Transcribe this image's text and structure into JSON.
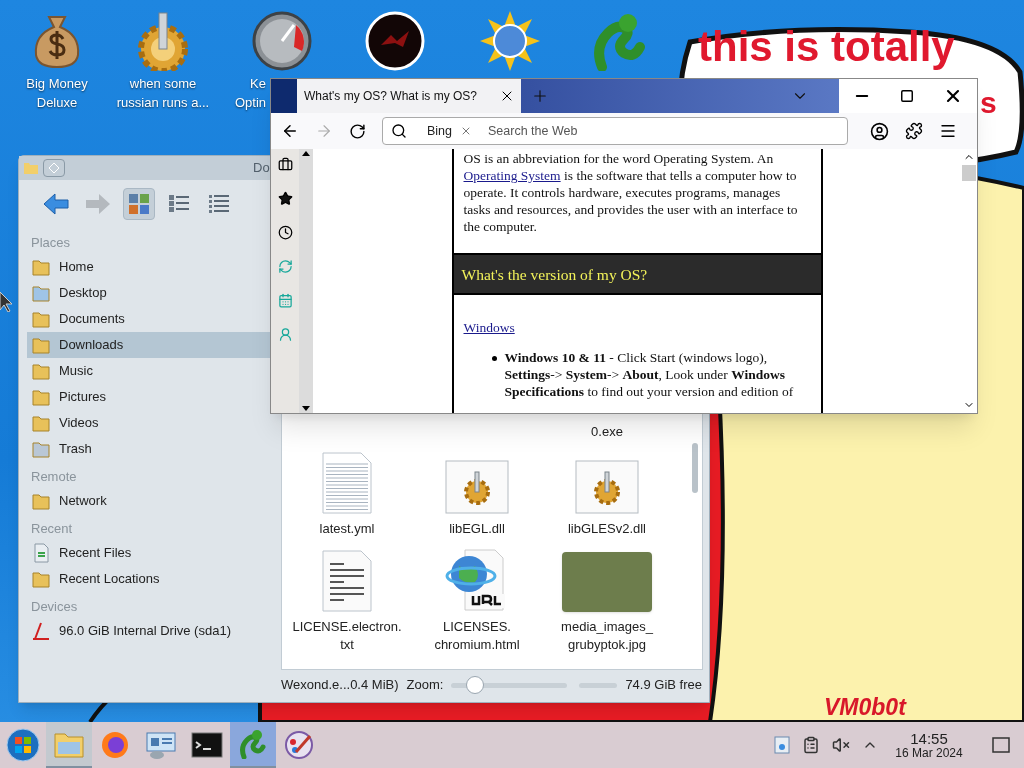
{
  "desktop_icons": [
    {
      "kind": "money",
      "lines": [
        "Big Money",
        "Deluxe"
      ]
    },
    {
      "kind": "gear",
      "lines": [
        "when some",
        "russian runs a..."
      ]
    },
    {
      "kind": "gauge",
      "lines": [
        "Ke",
        "Optin"
      ]
    },
    {
      "kind": "dark"
    },
    {
      "kind": "sun"
    },
    {
      "kind": "snake"
    }
  ],
  "wallpaper": {
    "bubble_text": "this is totally",
    "bubble_tail": "s",
    "signature": "VM0b0t"
  },
  "file_manager": {
    "title": "Do",
    "view_modes": [
      {
        "kind": "icons",
        "selected": true
      },
      {
        "kind": "details",
        "selected": false
      },
      {
        "kind": "compact",
        "selected": false
      }
    ],
    "sections": [
      {
        "title": "Places",
        "items": [
          {
            "kind": "home",
            "label": "Home",
            "selected": false
          },
          {
            "kind": "desktop",
            "label": "Desktop",
            "selected": false
          },
          {
            "kind": "folder",
            "label": "Documents",
            "selected": false
          },
          {
            "kind": "folder",
            "label": "Downloads",
            "selected": true
          },
          {
            "kind": "folder",
            "label": "Music",
            "selected": false
          },
          {
            "kind": "folder",
            "label": "Pictures",
            "selected": false
          },
          {
            "kind": "folder",
            "label": "Videos",
            "selected": false
          },
          {
            "kind": "trash",
            "label": "Trash",
            "selected": false
          }
        ]
      },
      {
        "title": "Remote",
        "items": [
          {
            "kind": "network",
            "label": "Network",
            "selected": false
          }
        ]
      },
      {
        "title": "Recent",
        "items": [
          {
            "kind": "recent",
            "label": "Recent Files",
            "selected": false
          },
          {
            "kind": "folder",
            "label": "Recent Locations",
            "selected": false
          }
        ]
      },
      {
        "title": "Devices",
        "items": [
          {
            "kind": "drive",
            "label": "96.0 GiB Internal Drive (sda1)",
            "selected": false
          }
        ]
      }
    ],
    "partial_label": "0.exe",
    "files": [
      {
        "kind": "text",
        "lines": [
          "latest.yml"
        ]
      },
      {
        "kind": "dll",
        "lines": [
          "libEGL.dll"
        ]
      },
      {
        "kind": "dll",
        "lines": [
          "libGLESv2.dll"
        ]
      },
      {
        "kind": "document",
        "lines": [
          "LICENSE.electron.",
          "txt"
        ]
      },
      {
        "kind": "url",
        "lines": [
          "LICENSES.",
          "chromium.html"
        ]
      },
      {
        "kind": "photo",
        "lines": [
          "media_images_",
          "grubyptok.jpg"
        ]
      }
    ],
    "status_text": "Wexond.e...0.4 MiB)",
    "zoom_label": "Zoom:",
    "zoom": {
      "level": 0.15
    },
    "free_space": "74.9 GiB free"
  },
  "browser": {
    "tab_title": "What's my OS? What is my OS?",
    "search_engine": "Bing",
    "search_placeholder": "Search the Web",
    "intro_before": "OS is an abbreviation for the word Operating System. An",
    "intro_link": "Operating System",
    "intro_after": "is the software that tells a computer how to operate. It controls hardware, executes programs, manages tasks and resources, and provides the user with an interface to the computer.",
    "heading": "What's the version of my OS?",
    "section_link": "Windows",
    "bullets": [
      "**Windows 10 & 11** - Click Start (windows logo), **Settings**-> **System**-> **About**, Look under **Windows Specifications** to find out your version and edition of"
    ]
  },
  "taskbar": {
    "items": [
      {
        "kind": "files",
        "open": true,
        "selected": false
      },
      {
        "kind": "firefox",
        "open": false,
        "selected": false
      },
      {
        "kind": "network",
        "open": false,
        "selected": false
      },
      {
        "kind": "terminal",
        "open": false,
        "selected": false
      },
      {
        "kind": "snake",
        "open": true,
        "selected": true
      },
      {
        "kind": "paint",
        "open": false,
        "selected": false
      }
    ],
    "time": "14:55",
    "date": "16 Mar 2024"
  }
}
